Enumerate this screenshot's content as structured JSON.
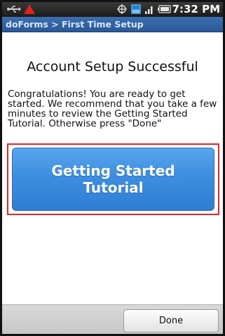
{
  "status_bar": {
    "icons": [
      "usb-icon",
      "warning-icon",
      "gps-icon",
      "3g-icon",
      "signal-icon",
      "battery-icon"
    ],
    "time": "7:32 PM"
  },
  "title_bar": {
    "title": "doForms > First Time Setup"
  },
  "main": {
    "heading": "Account Setup Successful",
    "message": "Congratulations! You are ready to get started. We recommend that you take a few minutes to review the Getting Started Tutorial. Otherwise press \"Done\"",
    "tutorial_button": "Getting Started Tutorial"
  },
  "footer": {
    "done_label": "Done"
  },
  "colors": {
    "title_bar": "#2f62a6",
    "button": "#3d8ee0",
    "highlight_border": "#e0242b"
  }
}
